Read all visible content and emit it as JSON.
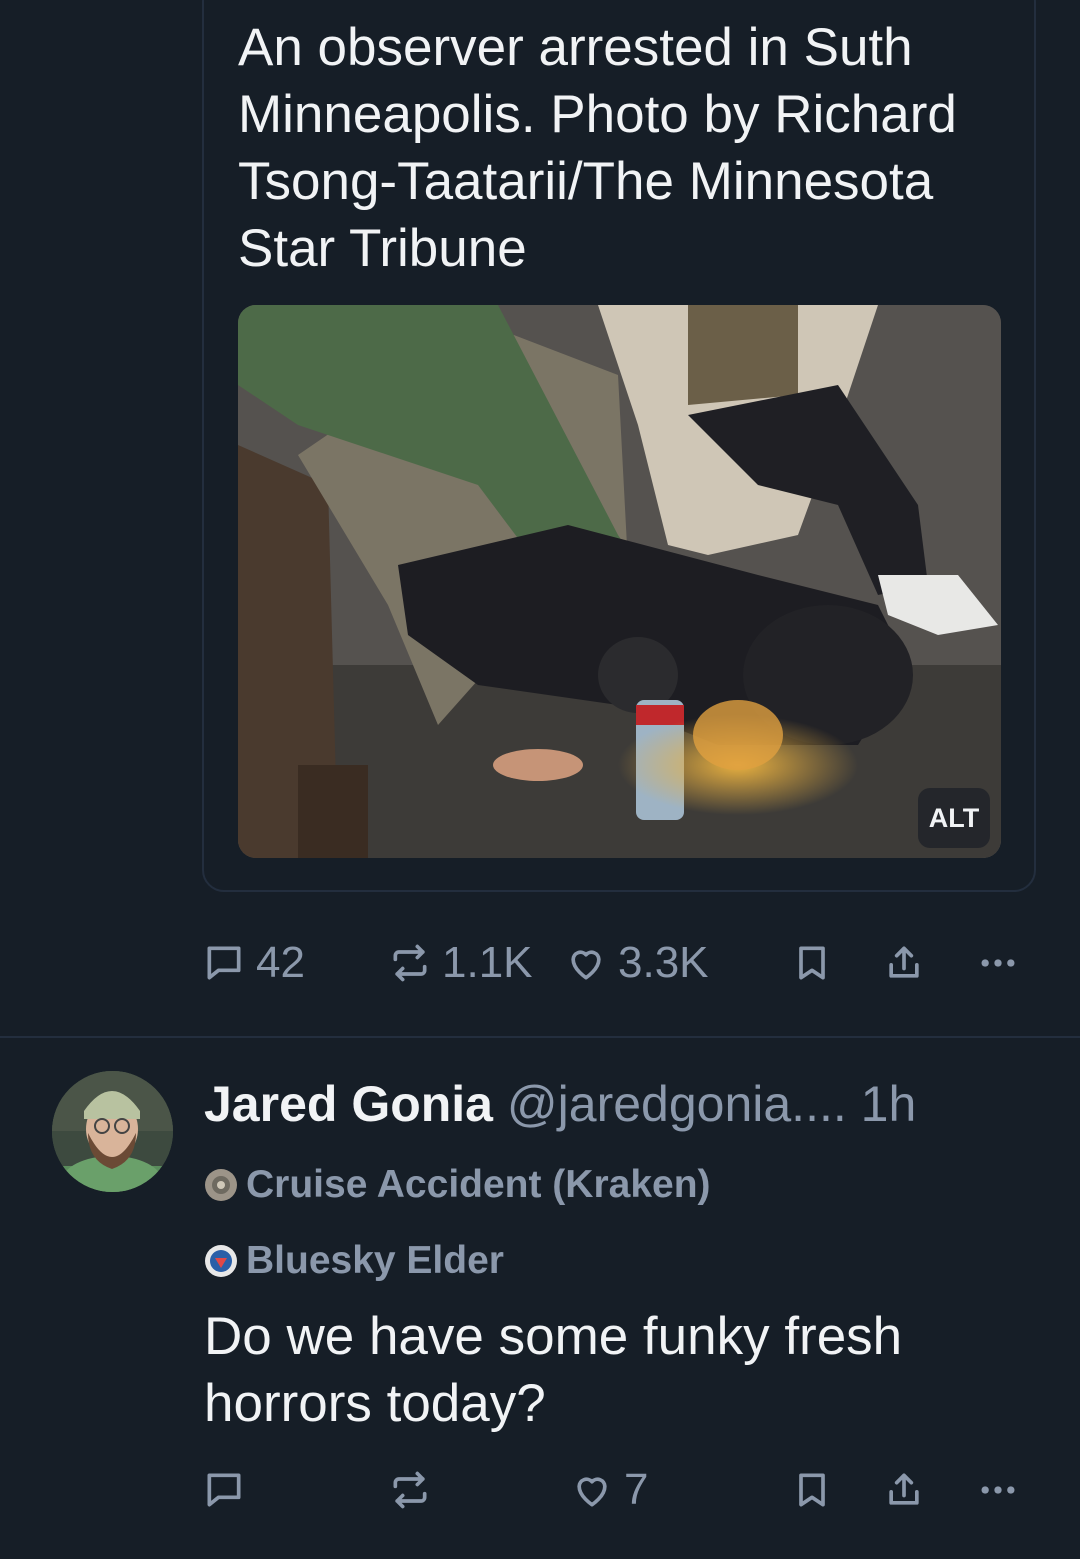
{
  "quoted_post": {
    "text": "An observer arrested in Suth Minneapolis. Photo by Richard Tsong-Taatarii/The Minnesota Star Tribune",
    "image_alt_badge": "ALT"
  },
  "main_actions": {
    "replies": "42",
    "reposts": "1.1K",
    "likes": "3.3K",
    "icons": [
      "reply-icon",
      "repost-icon",
      "like-icon",
      "bookmark-icon",
      "share-icon",
      "more-icon"
    ]
  },
  "reply_post": {
    "author_name": "Jared Gonia",
    "handle": "@jaredgonia....",
    "time": "1h",
    "badges": [
      {
        "label": "Cruise Accident (Kraken)"
      },
      {
        "label": "Bluesky Elder"
      }
    ],
    "text": "Do we have some funky fresh horrors today?",
    "actions": {
      "likes": "7"
    }
  },
  "colors": {
    "background": "#161e27",
    "border": "#232e3e",
    "text_primary": "#f1f3f5",
    "text_secondary": "#8b98ab"
  }
}
